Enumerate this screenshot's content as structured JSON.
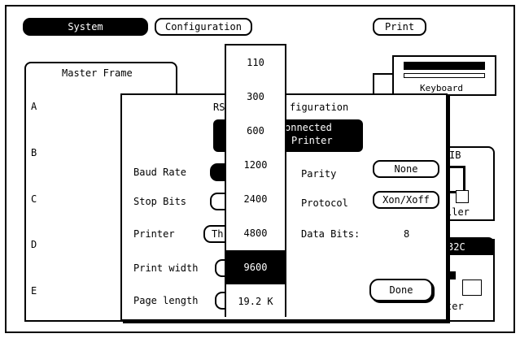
{
  "top_buttons": {
    "system": "System",
    "configuration": "Configuration",
    "print": "Print"
  },
  "master_frame": {
    "title": "Master Frame",
    "slots": [
      "A",
      "B",
      "C",
      "D",
      "E"
    ]
  },
  "keyboard": {
    "label": "Keyboard"
  },
  "right_cards": {
    "gpib_fragment": "IB",
    "controller_fragment": "ller",
    "rs232_fragment": "32C",
    "printer_fragment": "ter"
  },
  "rs232_dialog": {
    "title_left": "RS",
    "title_right": "figuration",
    "connected_label_line1": "onnected",
    "connected_label_line2": "Printer",
    "baud_rate_label": "Baud Rate",
    "stop_bits_label": "Stop Bits",
    "printer_label": "Printer",
    "printer_value_fragment": "Th",
    "print_width_label": "Print width",
    "page_length_label": "Page length",
    "parity_label": "Parity",
    "parity_value": "None",
    "protocol_label": "Protocol",
    "protocol_value": "Xon/Xoff",
    "data_bits_label": "Data Bits:",
    "data_bits_value": "8",
    "done_label": "Done"
  },
  "baud_dropdown": {
    "options": [
      "110",
      "300",
      "600",
      "1200",
      "2400",
      "4800",
      "9600",
      "19.2 K"
    ],
    "selected": "9600"
  }
}
